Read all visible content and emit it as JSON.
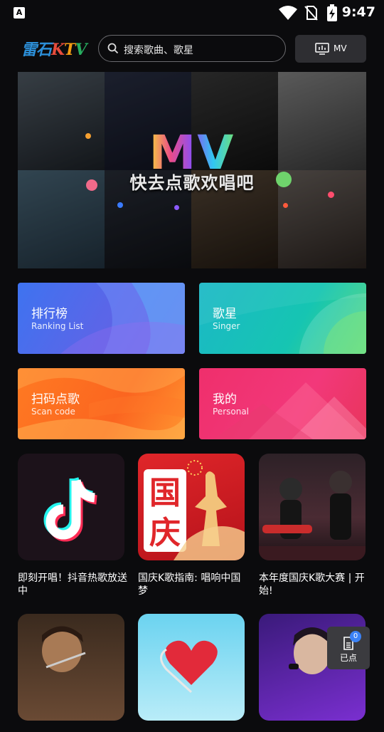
{
  "status_bar": {
    "time": "9:47",
    "app_badge": "A"
  },
  "header": {
    "logo": {
      "part1": "雷石",
      "part2": "K",
      "part3": "T",
      "part4": "V"
    },
    "search_placeholder": "搜索歌曲、歌星",
    "mv_button": "MV"
  },
  "banner": {
    "title": "MV",
    "tagline": "快去点歌欢唱吧"
  },
  "categories": [
    {
      "title": "排行榜",
      "subtitle": "Ranking List",
      "color": "#4f6cec"
    },
    {
      "title": "歌星",
      "subtitle": "Singer",
      "color": "#17bdb9"
    },
    {
      "title": "扫码点歌",
      "subtitle": "Scan code",
      "color": "#fb6d22"
    },
    {
      "title": "我的",
      "subtitle": "Personal",
      "color": "#ee3070"
    }
  ],
  "playlists": [
    {
      "caption": "即刻开唱！抖音热歌放送中",
      "icon": "tiktok-icon"
    },
    {
      "caption": "国庆K歌指南: 唱响中国梦",
      "art_text": "国庆"
    },
    {
      "caption": "本年度国庆K歌大赛 | 开始!"
    },
    {
      "caption": ""
    },
    {
      "caption": ""
    },
    {
      "caption": ""
    }
  ],
  "selected_button": {
    "count": "0",
    "label": "已点"
  }
}
